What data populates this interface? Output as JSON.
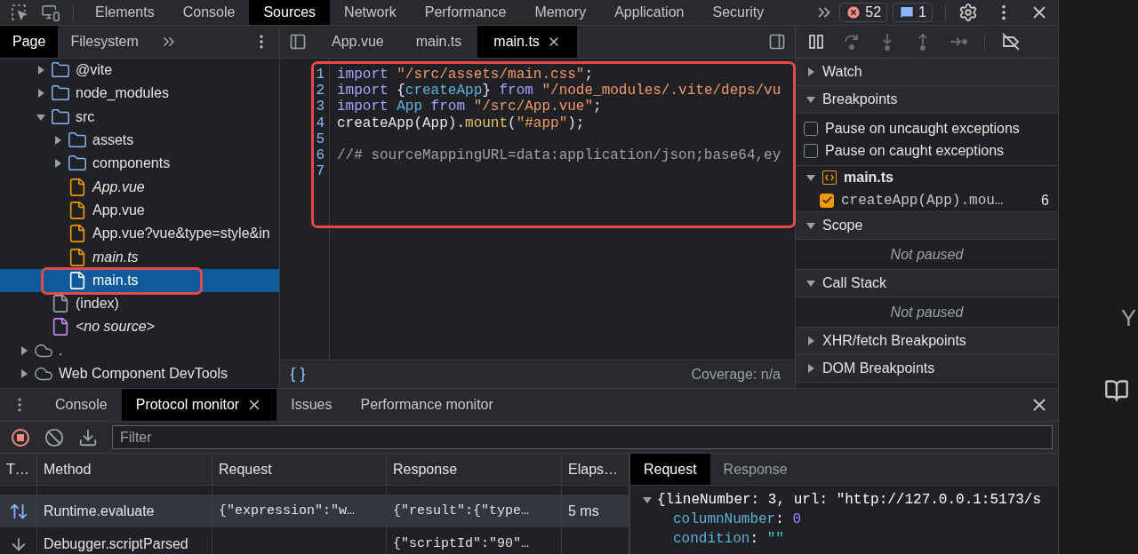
{
  "top_bar": {
    "tabs": [
      {
        "label": "Elements",
        "selected": false
      },
      {
        "label": "Console",
        "selected": false
      },
      {
        "label": "Sources",
        "selected": true
      },
      {
        "label": "Network",
        "selected": false
      },
      {
        "label": "Performance",
        "selected": false
      },
      {
        "label": "Memory",
        "selected": false
      },
      {
        "label": "Application",
        "selected": false
      },
      {
        "label": "Security",
        "selected": false
      }
    ],
    "error_count": "52",
    "message_count": "1"
  },
  "navigator": {
    "tabs": [
      {
        "label": "Page",
        "selected": true
      },
      {
        "label": "Filesystem",
        "selected": false
      }
    ],
    "tree_continued": [
      {
        "label": "@vite",
        "kind": "folder",
        "expanded": false,
        "selected": false
      },
      {
        "label": "node_modules",
        "kind": "folder",
        "expanded": false,
        "selected": false
      },
      {
        "label": "src",
        "kind": "folder",
        "expanded": true,
        "selected": false,
        "children": [
          {
            "label": "assets",
            "kind": "folder",
            "expanded": false,
            "selected": false
          },
          {
            "label": "components",
            "kind": "folder",
            "expanded": false,
            "selected": false
          },
          {
            "label": "App.vue",
            "kind": "file",
            "italic": true,
            "color": "#f29900",
            "selected": false
          },
          {
            "label": "App.vue",
            "kind": "file",
            "italic": false,
            "color": "#f29900",
            "selected": false
          },
          {
            "label": "App.vue?vue&type=style&in",
            "kind": "file",
            "italic": false,
            "color": "#f29900",
            "selected": false
          },
          {
            "label": "main.ts",
            "kind": "file",
            "italic": true,
            "color": "#f29900",
            "selected": false
          },
          {
            "label": "main.ts",
            "kind": "file",
            "italic": false,
            "color": "#ffffff",
            "selected": true
          }
        ]
      },
      {
        "label": "(index)",
        "kind": "file",
        "italic": false,
        "color": "#9aa0a6",
        "selected": false
      },
      {
        "label": "<no source>",
        "kind": "file",
        "italic": true,
        "color": "#c58af9",
        "selected": false
      }
    ],
    "tree": [
      {
        "label": ".",
        "kind": "cloud",
        "expanded": false,
        "selected": false
      },
      {
        "label": "Web Component DevTools",
        "kind": "cloud",
        "expanded": false,
        "selected": false
      }
    ]
  },
  "editor": {
    "tabs": [
      {
        "label": "App.vue",
        "selected": false,
        "closable": false
      },
      {
        "label": "main.ts",
        "selected": false,
        "closable": false
      },
      {
        "label": "main.ts",
        "selected": true,
        "closable": true
      }
    ],
    "code_lines": [
      {
        "number": "1",
        "tokens": [
          {
            "text": "import",
            "kind": "keyword"
          },
          {
            "text": " \"/src/assets/main.css\"",
            "kind": "string"
          },
          {
            "text": ";",
            "kind": "plain"
          }
        ]
      },
      {
        "number": "2",
        "tokens": [
          {
            "text": "import",
            "kind": "keyword"
          },
          {
            "text": " {",
            "kind": "plain"
          },
          {
            "text": "createApp",
            "kind": "variable"
          },
          {
            "text": "} ",
            "kind": "plain"
          },
          {
            "text": "from",
            "kind": "keyword"
          },
          {
            "text": " \"/node_modules/.vite/deps/vu",
            "kind": "string"
          }
        ]
      },
      {
        "number": "3",
        "tokens": [
          {
            "text": "import",
            "kind": "keyword"
          },
          {
            "text": " App",
            "kind": "variable"
          },
          {
            "text": " from",
            "kind": "keyword"
          },
          {
            "text": " \"/src/App.vue\"",
            "kind": "string"
          },
          {
            "text": ";",
            "kind": "plain"
          }
        ]
      },
      {
        "number": "4",
        "tokens": [
          {
            "text": "createApp(App).",
            "kind": "plain"
          },
          {
            "text": "mount",
            "kind": "function"
          },
          {
            "text": "(",
            "kind": "plain"
          },
          {
            "text": "\"#app\"",
            "kind": "string"
          },
          {
            "text": ");",
            "kind": "plain"
          }
        ]
      },
      {
        "number": "5"
      },
      {
        "number": "6",
        "tokens": [
          {
            "text": "//# sourceMappingURL=data:application/json;base64,ey",
            "kind": "comment"
          }
        ]
      },
      {
        "number": "7"
      }
    ],
    "coverage": "Coverage: n/a"
  },
  "debugger": {
    "toolbar": [
      {
        "kind": "pause",
        "disabled": false
      },
      {
        "kind": "step_over",
        "disabled": true
      },
      {
        "kind": "step_into",
        "disabled": true
      },
      {
        "kind": "step_out",
        "disabled": true
      },
      {
        "kind": "step",
        "disabled": true
      },
      {
        "kind": "deactivate",
        "disabled": false
      }
    ],
    "sections": [
      {
        "title": "Watch",
        "expanded": false
      },
      {
        "title": "Breakpoints",
        "expanded": true,
        "options": [
          {
            "label": "Pause on uncaught exceptions",
            "checked": false
          },
          {
            "label": "Pause on caught exceptions",
            "checked": false
          }
        ],
        "files": [
          {
            "name": "main.ts",
            "expanded": true,
            "breakpoints": [
              {
                "code": "createApp(App).mou…",
                "line": "6",
                "checked": true
              }
            ]
          }
        ]
      },
      {
        "title": "Scope",
        "expanded": true,
        "message": "Not paused"
      },
      {
        "title": "Call Stack",
        "expanded": true,
        "message": "Not paused"
      },
      {
        "title": "XHR/fetch Breakpoints",
        "expanded": false
      },
      {
        "title": "DOM Breakpoints",
        "expanded": false
      }
    ]
  },
  "drawer": {
    "tabs": [
      {
        "label": "Console",
        "selected": false,
        "closable": false
      },
      {
        "label": "Protocol monitor",
        "selected": true,
        "closable": true
      },
      {
        "label": "Issues",
        "selected": false,
        "closable": false
      },
      {
        "label": "Performance monitor",
        "selected": false,
        "closable": false
      }
    ],
    "recording": true,
    "filter_placeholder": "Filter",
    "columns": [
      "T…",
      "Method",
      "Request",
      "Response",
      "Elaps…"
    ],
    "rows": [
      {
        "kind": "both",
        "method": "Runtime.evaluate",
        "request": "{\"expression\":\"w…",
        "response": "{\"result\":{\"type…",
        "elapsed": "5 ms",
        "selected": true
      },
      {
        "kind": "received",
        "method": "Debugger.scriptParsed",
        "response": "{\"scriptId\":\"90\"…",
        "selected": false
      }
    ],
    "detail": {
      "tabs": [
        {
          "label": "Request",
          "selected": true
        },
        {
          "label": "Response",
          "selected": false
        }
      ],
      "tree": {
        "summary": "{lineNumber: 3, url: \"http://127.0.0.1:5173/s",
        "expanded": true,
        "properties": [
          {
            "key": "columnNumber",
            "separator": ":",
            "value": "0",
            "kind": "number"
          },
          {
            "key": "condition",
            "separator": ":",
            "value": "\"\"",
            "kind": "string"
          }
        ]
      }
    }
  },
  "side_strip": {
    "text": "Y"
  }
}
